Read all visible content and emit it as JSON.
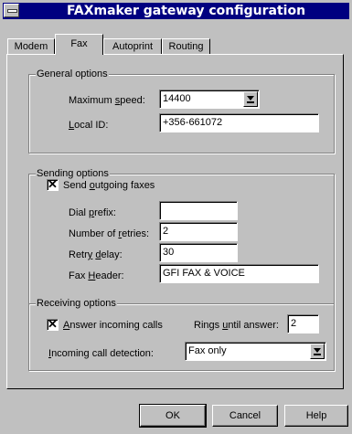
{
  "window": {
    "title": "FAXmaker gateway configuration"
  },
  "tabs": [
    {
      "label": "Modem",
      "active": false
    },
    {
      "label": "Fax",
      "active": true
    },
    {
      "label": "Autoprint",
      "active": false
    },
    {
      "label": "Routing",
      "active": false
    }
  ],
  "general": {
    "title": "General options",
    "max_speed_label": "Maximum speed:",
    "max_speed_value": "14400",
    "local_id_label": "Local ID:",
    "local_id_value": "+356-661072"
  },
  "sending": {
    "title": "Sending options",
    "send_outgoing_label": "Send outgoing faxes",
    "send_outgoing_checked": true,
    "dial_prefix_label": "Dial prefix:",
    "dial_prefix_value": "",
    "retries_label": "Number of retries:",
    "retries_value": "2",
    "retry_delay_label": "Retry delay:",
    "retry_delay_value": "30",
    "fax_header_label": "Fax Header:",
    "fax_header_value": "GFI FAX & VOICE"
  },
  "receiving": {
    "title": "Receiving options",
    "answer_label": "Answer incoming calls",
    "answer_checked": true,
    "rings_label": "Rings until answer:",
    "rings_value": "2",
    "detection_label": "Incoming call detection:",
    "detection_value": "Fax only"
  },
  "buttons": {
    "ok": "OK",
    "cancel": "Cancel",
    "help": "Help"
  }
}
